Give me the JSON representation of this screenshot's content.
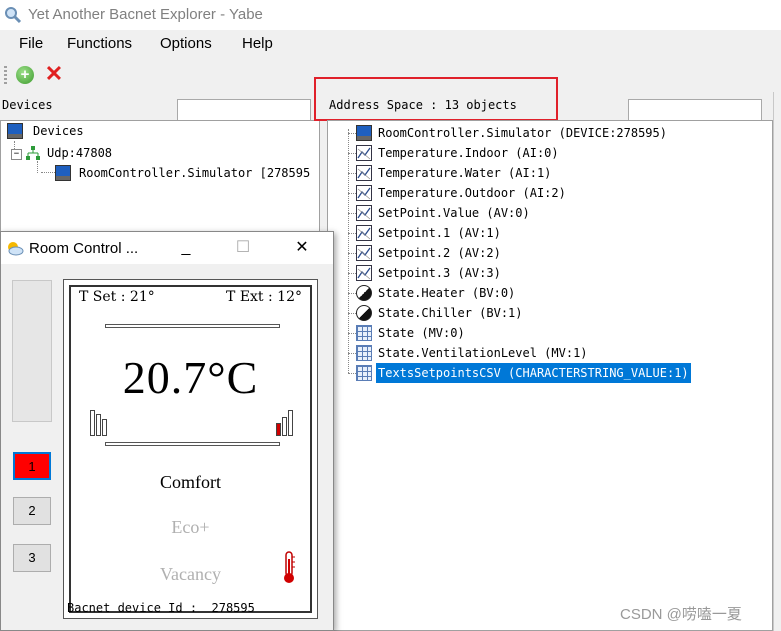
{
  "window": {
    "title": "Yet Another Bacnet Explorer - Yabe"
  },
  "menu": [
    {
      "label": "File"
    },
    {
      "label": "Functions"
    },
    {
      "label": "Options"
    },
    {
      "label": "Help"
    }
  ],
  "toolbar": {
    "add_icon": "add-circle-icon",
    "delete_icon": "red-x-icon"
  },
  "devices_panel": {
    "label": "Devices",
    "tree": {
      "root": "Devices",
      "transport": "Udp:47808",
      "device": "RoomController.Simulator [278595"
    }
  },
  "address_space": {
    "label": "Address Space : 13 objects",
    "items": [
      {
        "label": "RoomController.Simulator (DEVICE:278595)",
        "icon": "device"
      },
      {
        "label": "Temperature.Indoor (AI:0)",
        "icon": "analog"
      },
      {
        "label": "Temperature.Water (AI:1)",
        "icon": "analog"
      },
      {
        "label": "Temperature.Outdoor (AI:2)",
        "icon": "analog"
      },
      {
        "label": "SetPoint.Value (AV:0)",
        "icon": "analog"
      },
      {
        "label": "Setpoint.1 (AV:1)",
        "icon": "analog"
      },
      {
        "label": "Setpoint.2 (AV:2)",
        "icon": "analog"
      },
      {
        "label": "Setpoint.3 (AV:3)",
        "icon": "analog"
      },
      {
        "label": "State.Heater (BV:0)",
        "icon": "binary"
      },
      {
        "label": "State.Chiller (BV:1)",
        "icon": "binary"
      },
      {
        "label": "State (MV:0)",
        "icon": "multistate"
      },
      {
        "label": "State.VentilationLevel (MV:1)",
        "icon": "multistate"
      },
      {
        "label": "TextsSetpointsCSV (CHARACTERSTRING_VALUE:1)",
        "icon": "multistate",
        "selected": true
      }
    ]
  },
  "room_control": {
    "title": "Room Control ...",
    "controls": {
      "minimize": "_",
      "maximize": "☐",
      "close": "✕"
    },
    "t_set": "T Set : 21°",
    "t_ext": "T Ext : 12°",
    "temperature": "20.7°C",
    "modes": [
      "Comfort",
      "Eco+",
      "Vacancy"
    ],
    "active_mode": "Comfort",
    "buttons": [
      "1",
      "2",
      "3"
    ],
    "active_button": "1",
    "device_id_label": "Bacnet device Id :",
    "device_id": "278595",
    "colors": {
      "active_button": "#ff0000",
      "inactive_mode_text": "#b0b0b0",
      "heater_indicator": "#d00000"
    }
  },
  "watermark": "CSDN @唠嗑一夏"
}
